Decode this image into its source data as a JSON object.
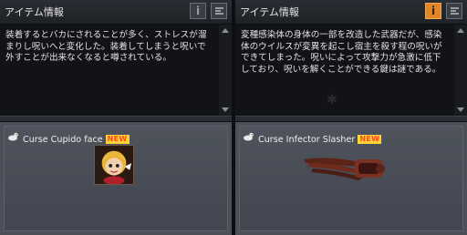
{
  "left": {
    "header_title": "アイテム情報",
    "description": "装着するとバカにされることが多く、ストレスが溜まりし呪いへと変化した。装着してしまうと呪いで外すことが出来なくなると噂されている。",
    "item_name": "Curse Cupido face",
    "new_badge": "NEW"
  },
  "right": {
    "header_title": "アイテム情報",
    "description": "変種感染体の身体の一部を改造した武器だが、感染体のウイルスが変異を起こし宿主を殺す程の呪いができてしまった。呪いによって攻撃力が急激に低下しており、呪いを解くことができる鍵は謎である。",
    "item_name": "Curse Infector Slasher",
    "new_badge": "NEW"
  },
  "colors": {
    "active_button": "#e0872a",
    "new_badge_bg": "#ffd23a",
    "new_badge_text": "#ff4a1a"
  }
}
